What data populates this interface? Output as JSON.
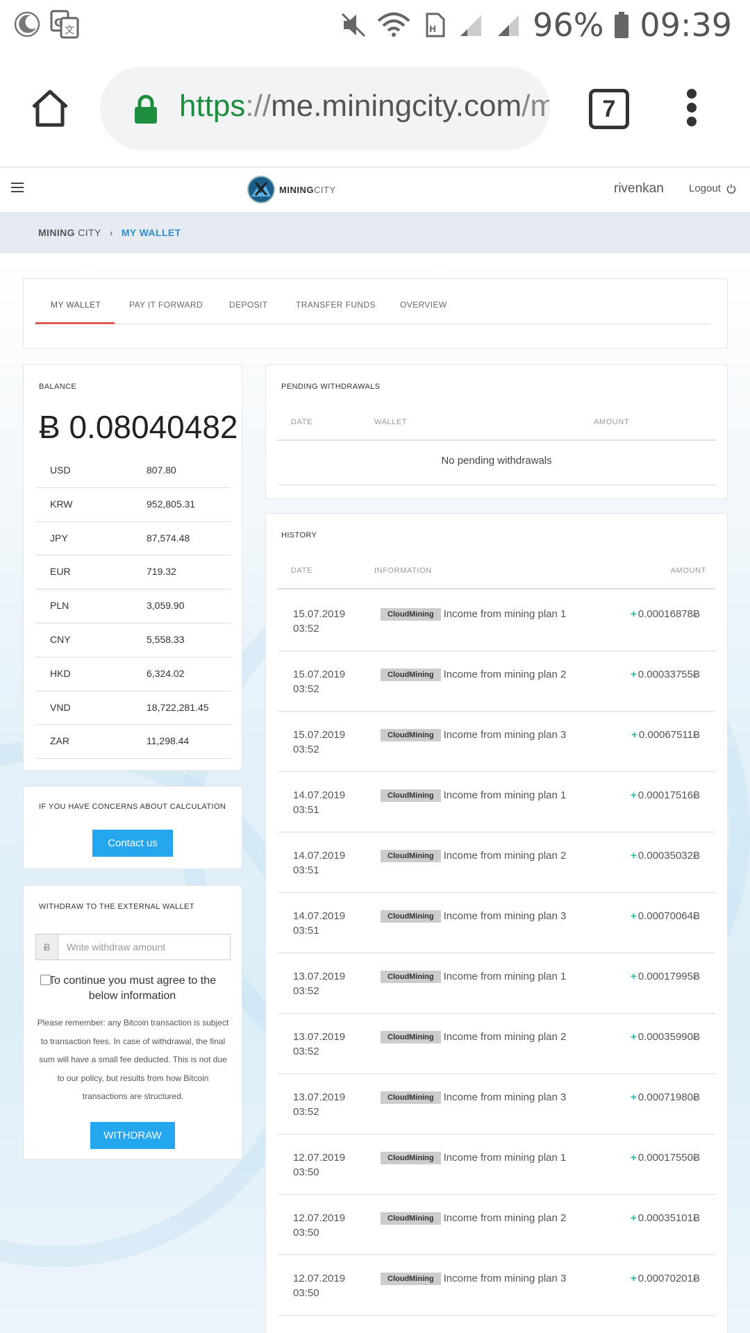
{
  "status_bar": {
    "battery": "96%",
    "time": "09:39"
  },
  "browser": {
    "url_scheme": "https",
    "url_sep": "://",
    "url_host": "me.miningcity.com",
    "url_path": "/my",
    "tab_count": "7"
  },
  "header": {
    "logo_bold": "MINING",
    "logo_light": "CITY",
    "username": "rivenkan",
    "logout_label": "Logout"
  },
  "breadcrumb": {
    "home_bold": "MINING",
    "home_light": "CITY",
    "separator": "›",
    "current": "MY WALLET"
  },
  "tabs": [
    "MY WALLET",
    "PAY IT FORWARD",
    "DEPOSIT",
    "TRANSFER FUNDS",
    "OVERVIEW"
  ],
  "balance": {
    "label": "BALANCE",
    "amount": "Ƀ 0.08040482",
    "currencies": [
      {
        "code": "USD",
        "value": "807.80"
      },
      {
        "code": "KRW",
        "value": "952,805.31"
      },
      {
        "code": "JPY",
        "value": "87,574.48"
      },
      {
        "code": "EUR",
        "value": "719.32"
      },
      {
        "code": "PLN",
        "value": "3,059.90"
      },
      {
        "code": "CNY",
        "value": "5,558.33"
      },
      {
        "code": "HKD",
        "value": "6,324.02"
      },
      {
        "code": "VND",
        "value": "18,722,281.45"
      },
      {
        "code": "ZAR",
        "value": "11,298.44"
      }
    ]
  },
  "concerns": {
    "label": "IF YOU HAVE CONCERNS ABOUT CALCULATION",
    "button": "Contact us"
  },
  "withdraw": {
    "label": "WITHDRAW TO THE EXTERNAL WALLET",
    "currency_symbol": "Ƀ",
    "placeholder": "Write withdraw amount",
    "agree_text": "To continue you must agree to the below information",
    "notice": "Please remember: any Bitcoin transaction is subject to transaction fees. In case of withdrawal, the final sum will have a small fee deducted. This is not due to our policy, but results from how Bitcoin transactions are structured.",
    "button": "WITHDRAW"
  },
  "pending": {
    "label": "PENDING WITHDRAWALS",
    "col_date": "DATE",
    "col_wallet": "WALLET",
    "col_amount": "AMOUNT",
    "empty": "No pending withdrawals"
  },
  "history": {
    "label": "HISTORY",
    "col_date": "DATE",
    "col_info": "INFORMATION",
    "col_amount": "AMOUNT",
    "badge": "CloudMining",
    "rows": [
      {
        "date": "15.07.2019",
        "time": "03:52",
        "info": "Income from mining plan 1",
        "amount": "0.00016878Ƀ"
      },
      {
        "date": "15.07.2019",
        "time": "03:52",
        "info": "Income from mining plan 2",
        "amount": "0.00033755Ƀ"
      },
      {
        "date": "15.07.2019",
        "time": "03:52",
        "info": "Income from mining plan 3",
        "amount": "0.00067511Ƀ"
      },
      {
        "date": "14.07.2019",
        "time": "03:51",
        "info": "Income from mining plan 1",
        "amount": "0.00017516Ƀ"
      },
      {
        "date": "14.07.2019",
        "time": "03:51",
        "info": "Income from mining plan 2",
        "amount": "0.00035032Ƀ"
      },
      {
        "date": "14.07.2019",
        "time": "03:51",
        "info": "Income from mining plan 3",
        "amount": "0.00070064Ƀ"
      },
      {
        "date": "13.07.2019",
        "time": "03:52",
        "info": "Income from mining plan 1",
        "amount": "0.00017995Ƀ"
      },
      {
        "date": "13.07.2019",
        "time": "03:52",
        "info": "Income from mining plan 2",
        "amount": "0.00035990Ƀ"
      },
      {
        "date": "13.07.2019",
        "time": "03:52",
        "info": "Income from mining plan 3",
        "amount": "0.00071980Ƀ"
      },
      {
        "date": "12.07.2019",
        "time": "03:50",
        "info": "Income from mining plan 1",
        "amount": "0.00017550Ƀ"
      },
      {
        "date": "12.07.2019",
        "time": "03:50",
        "info": "Income from mining plan 2",
        "amount": "0.00035101Ƀ"
      },
      {
        "date": "12.07.2019",
        "time": "03:50",
        "info": "Income from mining plan 3",
        "amount": "0.00070201Ƀ"
      }
    ]
  },
  "colors": {
    "accent_blue": "#25a7f0",
    "breadcrumb_active": "#2d8ec7",
    "tab_active_underline": "#e05a5a",
    "income_plus": "#2bb5a0",
    "url_secure_green": "#1e8e3e"
  }
}
